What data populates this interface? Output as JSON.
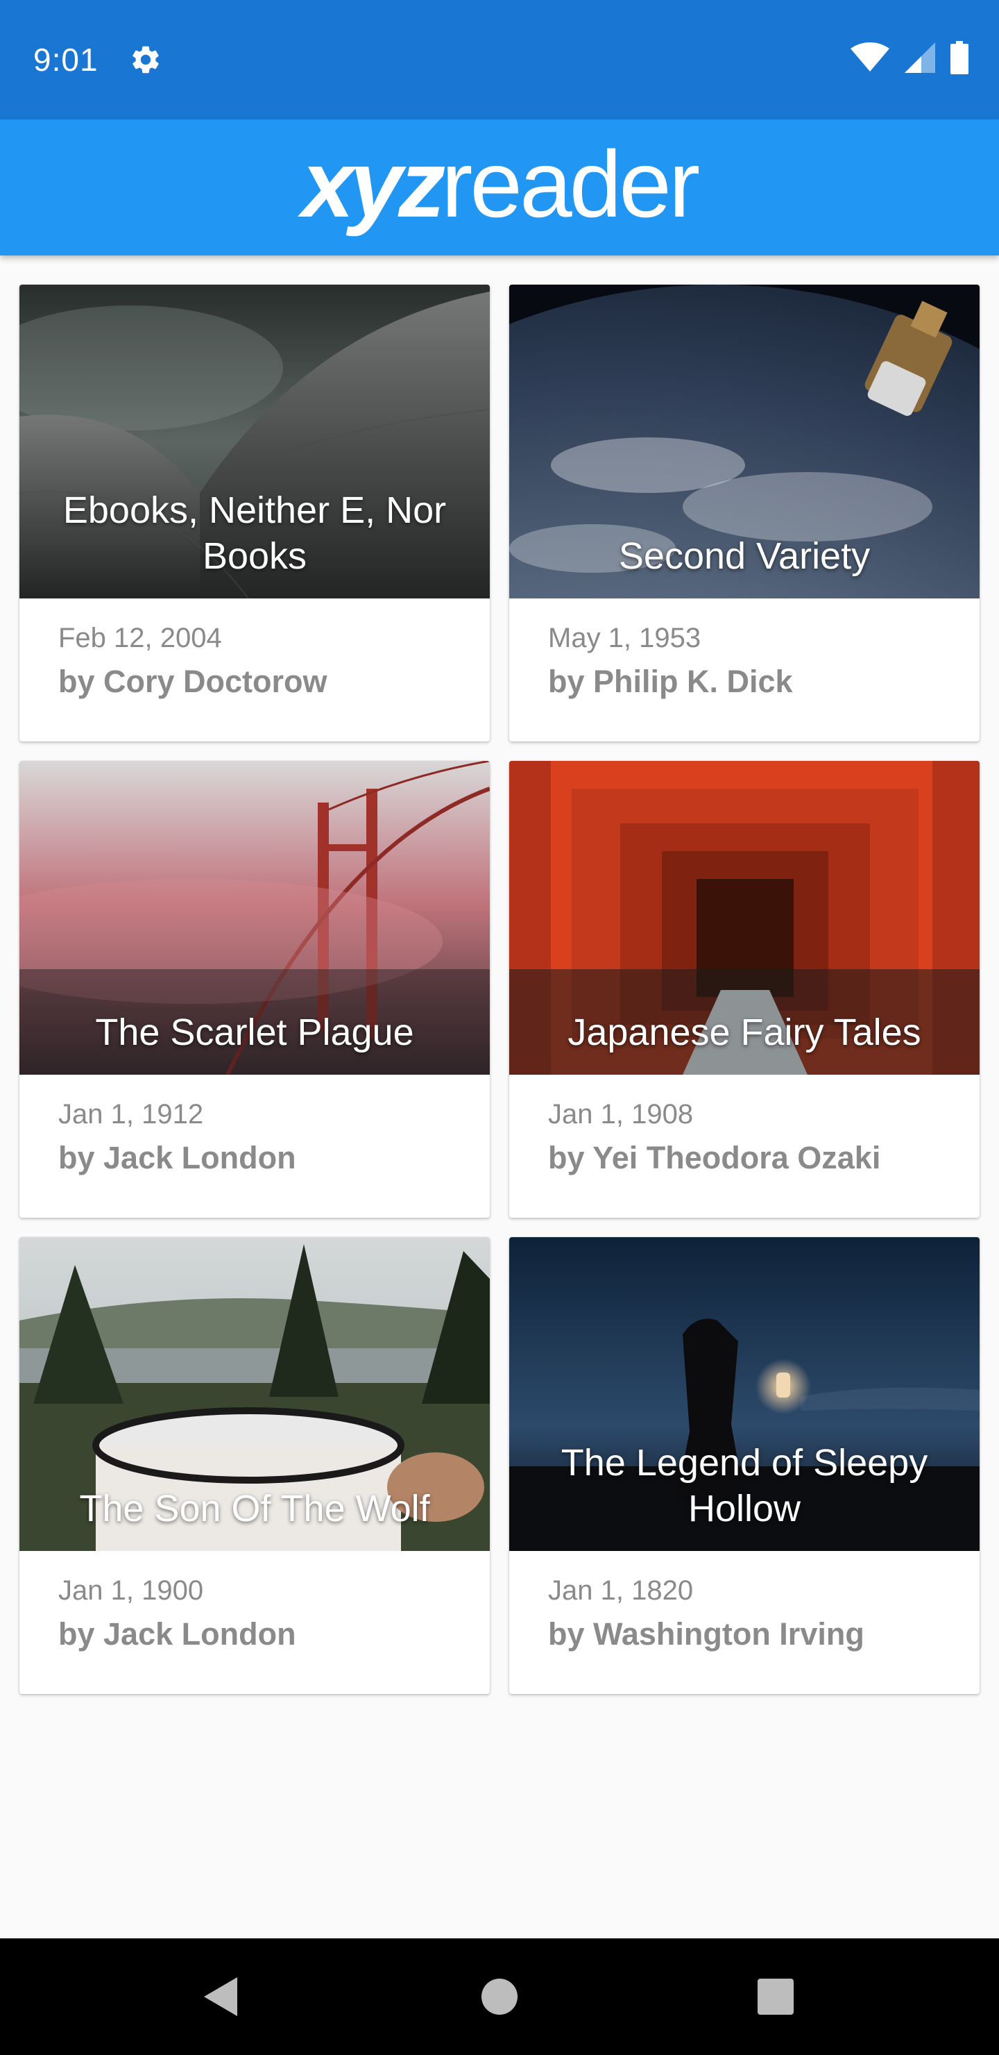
{
  "status_bar": {
    "time": "9:01",
    "icons": [
      "settings-icon",
      "wifi-icon",
      "cell-signal-icon",
      "battery-icon"
    ],
    "color": "#1976D2"
  },
  "app_bar": {
    "logo_bold": "xyz",
    "logo_regular": "reader",
    "color": "#2196F3"
  },
  "articles": [
    {
      "title": "Ebooks, Neither E, Nor Books",
      "date": "Feb 12, 2004",
      "author": "by Cory Doctorow"
    },
    {
      "title": "Second Variety",
      "date": "May 1, 1953",
      "author": "by Philip K. Dick"
    },
    {
      "title": "The Scarlet Plague",
      "date": "Jan 1, 1912",
      "author": "by Jack London"
    },
    {
      "title": "Japanese Fairy Tales",
      "date": "Jan 1, 1908",
      "author": "by Yei Theodora Ozaki"
    },
    {
      "title": "The Son Of The Wolf",
      "date": "Jan 1, 1900",
      "author": "by Jack London"
    },
    {
      "title": "The Legend of Sleepy Hollow",
      "date": "Jan 1, 1820",
      "author": "by Washington Irving"
    }
  ],
  "nav_bar": {
    "buttons": [
      "back-icon",
      "home-icon",
      "recents-icon"
    ]
  }
}
